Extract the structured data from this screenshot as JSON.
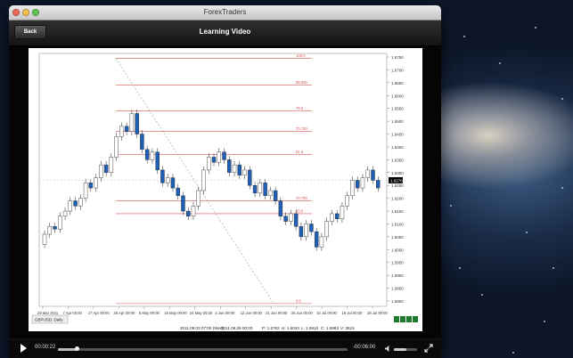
{
  "window": {
    "title": "ForexTraders"
  },
  "navbar": {
    "back_label": "Back",
    "title": "Learning Video"
  },
  "chart_data": {
    "type": "candlestick",
    "symbol_tab": "GBPUSD, Daily",
    "price_axis": [
      "1.6750",
      "1.6700",
      "1.6650",
      "1.6600",
      "1.6550",
      "1.6500",
      "1.6450",
      "1.6400",
      "1.6350",
      "1.6300",
      "1.6250",
      "1.6200",
      "1.6150",
      "1.6100",
      "1.6050",
      "1.6000",
      "1.5950",
      "1.5900",
      "1.5850",
      "1.5800"
    ],
    "current_price": "1.6270",
    "date_axis": [
      "29 Mar 2011",
      "7 Apr 00:00",
      "17 Apr 00:00",
      "28 Apr 00:00",
      "6 May 00:00",
      "15 May 00:00",
      "24 May 00:00",
      "2 Jun 00:00",
      "12 Jun 00:00",
      "21 Jun 00:00",
      "30 Jun 00:00",
      "10 Jul 00:00",
      "19 Jul 00:00",
      "28 Jul 00:00"
    ],
    "fib_levels": [
      "100.0",
      "88.600",
      "78.6",
      "70.700",
      "61.8",
      "70.700",
      "50.0",
      "0.0"
    ],
    "status_bar": {
      "datetime": "2011.06.03 07:00 (Wed)",
      "open": "2011.06.28 00:00",
      "p": "P: 1.5762",
      "h": "H: 1.6042",
      "l": "L: 1.5910",
      "c": "C: 1.5983",
      "v": "V: 3615"
    }
  },
  "player": {
    "elapsed": "00:00:22",
    "remaining": "-00:06:00",
    "progress": 0.064,
    "volume": 0.55
  },
  "colors": {
    "bull": "#ffffff",
    "bear": "#1f5fb5",
    "fib": "#d9534f"
  }
}
